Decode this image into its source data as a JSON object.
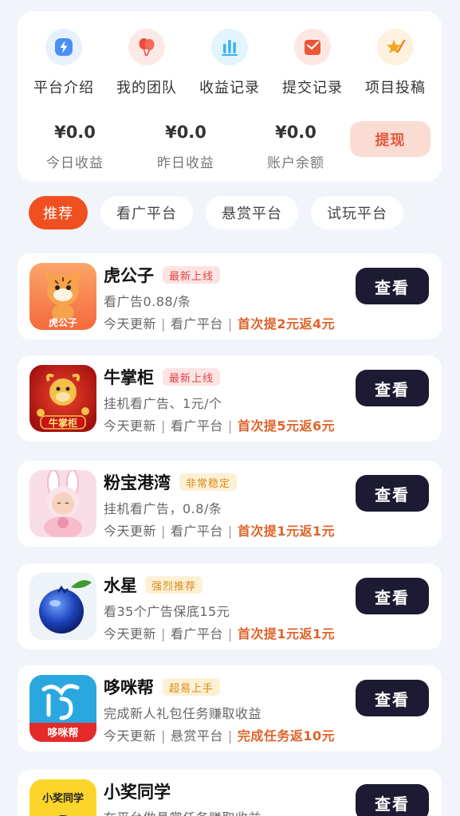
{
  "quick_menu": [
    {
      "label": "平台介绍",
      "icon": "lightning-icon",
      "color": "#4a8ff5",
      "bg": "#e7f1fd"
    },
    {
      "label": "我的团队",
      "icon": "balloons-icon",
      "color": "#ee4a3e",
      "bg": "#fde9e6"
    },
    {
      "label": "收益记录",
      "icon": "bar-chart-icon",
      "color": "#3bb3e9",
      "bg": "#e2f4fc"
    },
    {
      "label": "提交记录",
      "icon": "envelope-icon",
      "color": "#ef5638",
      "bg": "#fde7e2"
    },
    {
      "label": "项目投稿",
      "icon": "star-pen-icon",
      "color": "#f5a623",
      "bg": "#fef1df"
    }
  ],
  "stats": [
    {
      "value": "¥0.0",
      "label": "今日收益"
    },
    {
      "value": "¥0.0",
      "label": "昨日收益"
    },
    {
      "value": "¥0.0",
      "label": "账户余额"
    }
  ],
  "withdraw_label": "提现",
  "tabs": [
    "推荐",
    "看广平台",
    "悬赏平台",
    "试玩平台"
  ],
  "active_tab": 0,
  "view_label": "查看",
  "apps": [
    {
      "name": "虎公子",
      "badge": "最新上线",
      "badge_style": "red",
      "desc": "看广告0.88/条",
      "meta": [
        "今天更新",
        "看广平台"
      ],
      "promo": "首次提2元返4元",
      "icon_text": "虎公子"
    },
    {
      "name": "牛掌柜",
      "badge": "最新上线",
      "badge_style": "red",
      "desc": "挂机看广告、1元/个",
      "meta": [
        "今天更新",
        "看广平台"
      ],
      "promo": "首次提5元返6元",
      "icon_text": "牛掌柜"
    },
    {
      "name": "粉宝港湾",
      "badge": "非常稳定",
      "badge_style": "yellow",
      "desc": "挂机看广告，0.8/条",
      "meta": [
        "今天更新",
        "看广平台"
      ],
      "promo": "首次提1元返1元",
      "icon_text": ""
    },
    {
      "name": "水星",
      "badge": "强烈推荐",
      "badge_style": "yellow",
      "desc": "看35个广告保底15元",
      "meta": [
        "今天更新",
        "看广平台"
      ],
      "promo": "首次提1元返1元",
      "icon_text": ""
    },
    {
      "name": "哆咪帮",
      "badge": "超易上手",
      "badge_style": "yellow",
      "desc": "完成新人礼包任务赚取收益",
      "meta": [
        "今天更新",
        "悬赏平台"
      ],
      "promo": "完成任务返10元",
      "icon_text": "哆咪帮"
    },
    {
      "name": "小奖同学",
      "badge": "",
      "badge_style": "",
      "desc": "在平台做悬赏任务赚取收益",
      "meta": [],
      "promo": "",
      "icon_text": "小奖同学"
    }
  ]
}
